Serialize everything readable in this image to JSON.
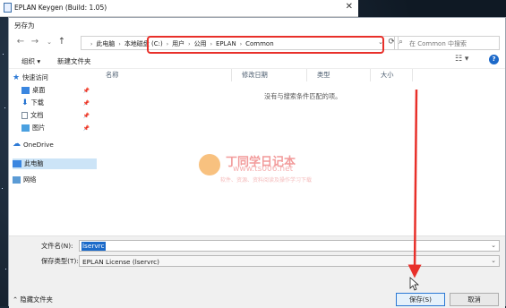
{
  "back_window": {
    "title": "EPLAN Keygen (Build: 1.05)",
    "close": "✕"
  },
  "dialog": {
    "title": "另存为",
    "nav": {
      "back": "←",
      "forward": "→",
      "up": "↑"
    },
    "address": {
      "items": [
        "此电脑",
        "本地磁盘 (C:)",
        "用户",
        "公用",
        "EPLAN",
        "Common"
      ],
      "sep": "›"
    },
    "search": {
      "placeholder": "在 Common 中搜索"
    },
    "toolbar": {
      "organize": "组织 ▾",
      "new_folder": "新建文件夹"
    },
    "sidebar": {
      "items": [
        {
          "label": "快速访问"
        },
        {
          "label": "桌面"
        },
        {
          "label": "下载"
        },
        {
          "label": "文档"
        },
        {
          "label": "图片"
        },
        {
          "label": "OneDrive"
        },
        {
          "label": "此电脑"
        },
        {
          "label": "网络"
        }
      ]
    },
    "columns": [
      "名称",
      "修改日期",
      "类型",
      "大小"
    ],
    "empty_text": "没有与搜索条件匹配的项。",
    "watermark": {
      "title": "丁同学日记本",
      "url": "www.ts006.net",
      "subtitle": "软件、资源、资料阅读及操作学习下载"
    },
    "file_name": {
      "label": "文件名(N):",
      "value": "lservrc"
    },
    "file_type": {
      "label": "保存类型(T):",
      "value": "EPLAN License (lservrc)"
    },
    "hide_folders": "⌃ 隐藏文件夹",
    "save": "保存(S)",
    "cancel": "取消"
  }
}
